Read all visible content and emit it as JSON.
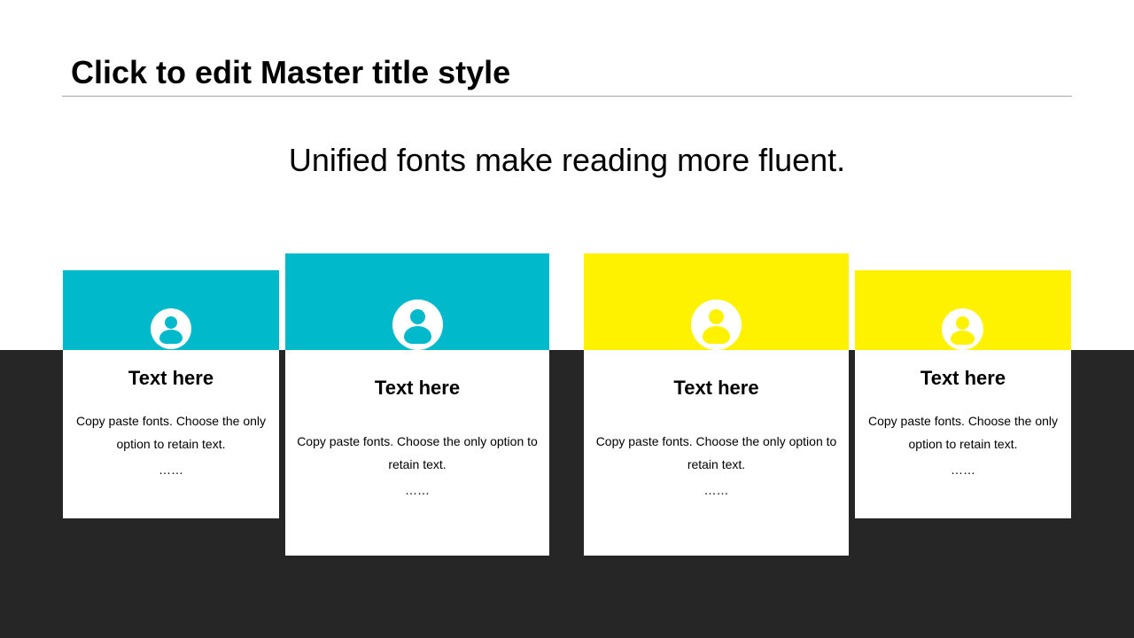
{
  "slide": {
    "title": "Click to edit Master title style",
    "subtitle": "Unified fonts make reading more fluent."
  },
  "colors": {
    "teal": "#00b9cb",
    "yellow": "#fff200",
    "dark": "#262626"
  },
  "cards": [
    {
      "heading": "Text here",
      "text": "Copy paste fonts. Choose the only option to retain text.",
      "dots": "……",
      "icon": "user-icon"
    },
    {
      "heading": "Text here",
      "text": "Copy paste fonts. Choose the only option to retain text.",
      "dots": "……",
      "icon": "user-icon"
    },
    {
      "heading": "Text here",
      "text": "Copy paste fonts. Choose the only option to retain text.",
      "dots": "……",
      "icon": "user-icon"
    },
    {
      "heading": "Text here",
      "text": "Copy paste fonts. Choose the only option to retain text.",
      "dots": "……",
      "icon": "user-icon"
    }
  ]
}
